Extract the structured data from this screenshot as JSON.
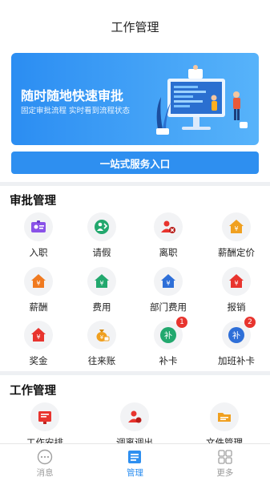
{
  "header": {
    "title": "工作管理"
  },
  "banner": {
    "title": "随时随地快速审批",
    "subtitle": "固定审批流程  实时看到流程状态"
  },
  "entry_button": {
    "label": "一站式服务入口"
  },
  "approval": {
    "title": "审批管理",
    "items": [
      {
        "label": "入职",
        "icon": "id-card-icon",
        "color": "#8a52e8"
      },
      {
        "label": "请假",
        "icon": "person-leave-icon",
        "color": "#22a86e"
      },
      {
        "label": "离职",
        "icon": "person-remove-icon",
        "color": "#e8342e"
      },
      {
        "label": "薪酬定价",
        "icon": "salary-house-icon",
        "color": "#f0a020"
      },
      {
        "label": "薪酬",
        "icon": "salary-house-icon",
        "color": "#f07a20"
      },
      {
        "label": "费用",
        "icon": "expense-house-icon",
        "color": "#22a86e"
      },
      {
        "label": "部门费用",
        "icon": "department-expense-icon",
        "color": "#2e6fd8"
      },
      {
        "label": "报销",
        "icon": "reimburse-house-icon",
        "color": "#e8342e"
      },
      {
        "label": "奖金",
        "icon": "bonus-house-icon",
        "color": "#e8342e"
      },
      {
        "label": "往来账",
        "icon": "money-bag-icon",
        "color": "#f0a020"
      },
      {
        "label": "补卡",
        "icon": "supplement-card-icon",
        "color": "#22a86e",
        "badge": "1"
      },
      {
        "label": "加班补卡",
        "icon": "overtime-card-icon",
        "color": "#2e6fd8",
        "badge": "2"
      }
    ]
  },
  "work": {
    "title": "工作管理",
    "items": [
      {
        "label": "工作安排",
        "icon": "work-schedule-icon",
        "color": "#e8342e"
      },
      {
        "label": "调离调出",
        "icon": "transfer-icon",
        "color": "#e8342e"
      },
      {
        "label": "文件管理",
        "icon": "folder-icon",
        "color": "#f0a020"
      }
    ]
  },
  "tabbar": {
    "tabs": [
      {
        "label": "消息",
        "icon": "message-icon"
      },
      {
        "label": "管理",
        "icon": "manage-icon",
        "active": true
      },
      {
        "label": "更多",
        "icon": "more-grid-icon"
      }
    ],
    "active_color": "#2e8ff0"
  }
}
